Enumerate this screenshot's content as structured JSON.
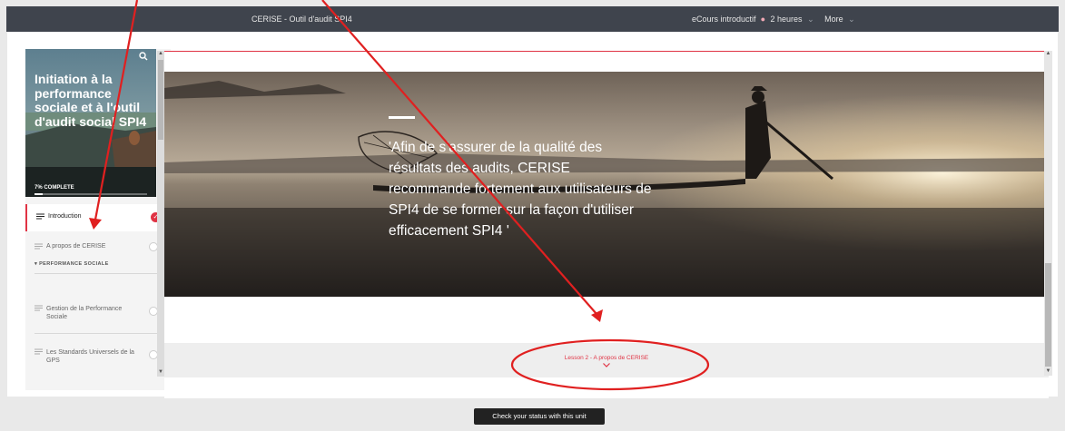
{
  "topbar": {
    "title": "CERISE - Outil d'audit SPI4",
    "course_link": "eCours introductif",
    "duration": "2 heures",
    "more": "More",
    "caret": "⌄"
  },
  "sidebar": {
    "course_title": "Initiation à la performance sociale et à l'outil d'audit social SPI4",
    "progress_label": "7% COMPLETE",
    "progress": 0.07,
    "items": [
      {
        "label": "Introduction",
        "done": true,
        "active": true
      },
      {
        "label": "A propos de CERISE",
        "done": false
      },
      {
        "label": "PERFORMANCE SOCIALE",
        "section": true
      },
      {
        "label": "Gestion de la Performance Sociale",
        "done": false
      },
      {
        "label": "Les Standards Universels de la GPS",
        "done": false
      }
    ]
  },
  "banner": {
    "quote": "'Afin de s'assurer de la qualité des résultats des audits, CERISE recommande fortement aux utilisateurs de SPI4 de se former sur la façon d'utiliser efficacement SPI4 '"
  },
  "next_lesson": {
    "label": "Lesson 2 - A propos de CERISE"
  },
  "footer": {
    "status_button": "Check your status with this unit"
  },
  "colors": {
    "accent": "#e03344",
    "topbar": "#3f444d",
    "annotation": "#e02020"
  }
}
